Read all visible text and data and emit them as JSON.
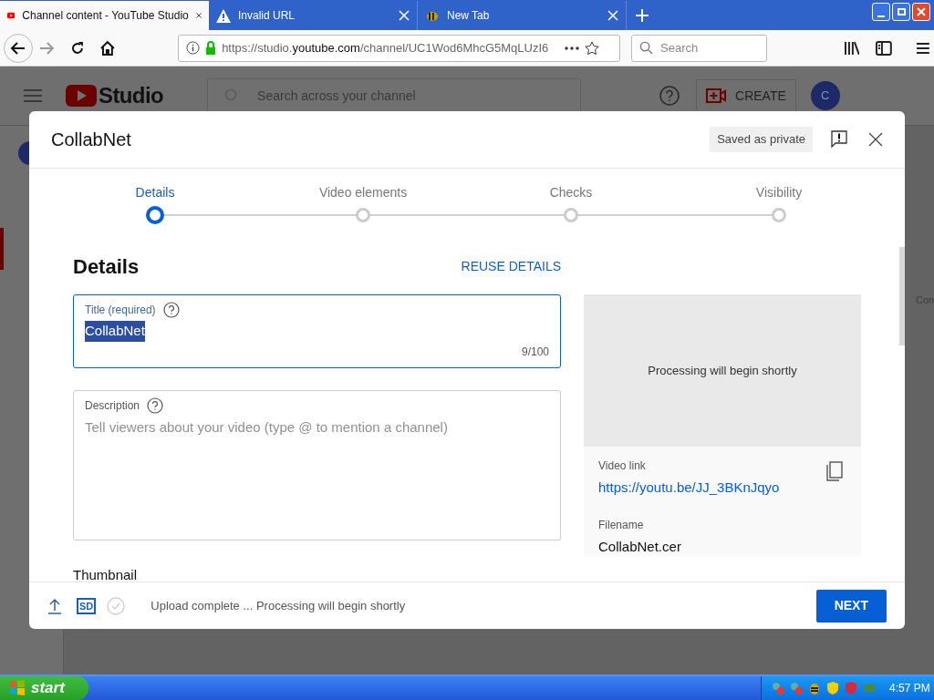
{
  "browser": {
    "tabs": [
      {
        "title": "Channel content - YouTube Studio",
        "kind": "youtube",
        "selected": true
      },
      {
        "title": "Invalid URL",
        "kind": "warning",
        "selected": false
      },
      {
        "title": "New Tab",
        "kind": "bee",
        "selected": false
      }
    ],
    "url_prefix": "https://studio.",
    "url_domain": "youtube.com",
    "url_rest": "/channel/UC1Wod6MhcG5MqLUzI6",
    "search_placeholder": "Search"
  },
  "studio": {
    "logo": "Studio",
    "search_placeholder": "Search across your channel",
    "create": "CREATE",
    "avatar": "C",
    "side_text": "Con"
  },
  "dialog": {
    "title": "CollabNet",
    "saved": "Saved as private",
    "steps": [
      {
        "label": "Details",
        "selected": true
      },
      {
        "label": "Video elements",
        "selected": false
      },
      {
        "label": "Checks",
        "selected": false
      },
      {
        "label": "Visibility",
        "selected": false
      }
    ],
    "heading": "Details",
    "reuse": "REUSE DETAILS",
    "title_field": {
      "label": "Title (required)",
      "value": "CollabNet",
      "counter": "9/100"
    },
    "description_field": {
      "label": "Description",
      "placeholder": "Tell viewers about your video (type @ to mention a channel)"
    },
    "preview": {
      "status": "Processing will begin shortly",
      "link_label": "Video link",
      "link": "https://youtu.be/JJ_3BKnJqyo",
      "filename_label": "Filename",
      "filename": "CollabNet.cer"
    },
    "thumbnail": "Thumbnail",
    "footer": {
      "badge": "SD",
      "status": "Upload complete ... Processing will begin shortly",
      "next": "NEXT"
    }
  },
  "taskbar": {
    "start": "start",
    "clock": "4:57 PM"
  }
}
